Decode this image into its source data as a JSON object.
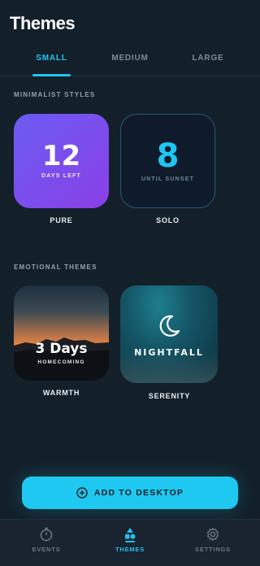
{
  "header": {
    "title": "Themes"
  },
  "tabs": [
    {
      "label": "SMALL",
      "active": true
    },
    {
      "label": "MEDIUM",
      "active": false
    },
    {
      "label": "LARGE",
      "active": false
    }
  ],
  "sections": {
    "minimalist": {
      "label": "MINIMALIST STYLES",
      "cards": [
        {
          "number": "12",
          "subtitle": "DAYS LEFT",
          "caption": "PURE"
        },
        {
          "number": "8",
          "subtitle": "UNTIL SUNSET",
          "caption": "SOLO"
        }
      ]
    },
    "emotional": {
      "label": "EMOTIONAL THEMES",
      "cards": [
        {
          "headline": "3 Days",
          "subtitle": "HOMECOMING",
          "caption": "WARMTH"
        },
        {
          "headline": "NIGHTFALL",
          "icon": "moon-icon",
          "caption": "SERENITY"
        }
      ]
    }
  },
  "action": {
    "label": "ADD TO DESKTOP",
    "icon": "plus-circle-icon"
  },
  "bottom_nav": [
    {
      "label": "EVENTS",
      "icon": "stopwatch-icon",
      "active": false
    },
    {
      "label": "THEMES",
      "icon": "shapes-icon",
      "active": true
    },
    {
      "label": "SETTINGS",
      "icon": "gear-icon",
      "active": false
    }
  ],
  "colors": {
    "accent": "#22c4ee",
    "background": "#13202a",
    "pure_gradient_start": "#6c5cf3",
    "pure_gradient_end": "#8a3fe6",
    "solo_number": "#1ec6f2"
  }
}
